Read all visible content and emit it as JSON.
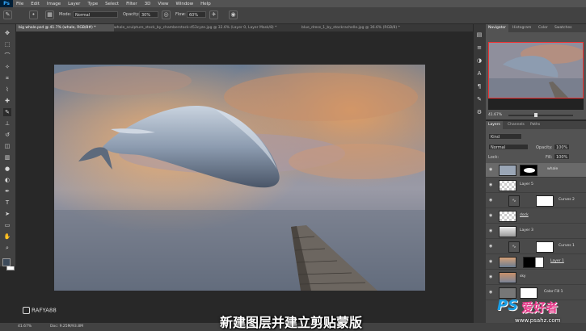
{
  "app": {
    "logo": "Ps"
  },
  "menu": [
    "File",
    "Edit",
    "Image",
    "Layer",
    "Type",
    "Select",
    "Filter",
    "3D",
    "View",
    "Window",
    "Help"
  ],
  "options": {
    "mode_label": "Mode:",
    "mode_value": "Normal",
    "opacity_label": "Opacity:",
    "opacity_value": "30%",
    "flow_label": "Flow:",
    "flow_value": "60%"
  },
  "tabs": [
    {
      "label": "big whale.psd @ 41.7% (whale, RGB/8#) *",
      "active": true
    },
    {
      "label": "whale_sculpture_stock_by_chamberstock-d53cyze.jpg @ 32.6% (Layer 0, Layer Mask/8) *",
      "active": false
    },
    {
      "label": "blue_dress_1_by_stockrachelle.jpg @ 36.6% (RGB/8) *",
      "active": false
    }
  ],
  "navigator": {
    "tabs": [
      "Navigator",
      "Histogram",
      "Color",
      "Swatches"
    ],
    "zoom": "41.67%"
  },
  "layers_panel": {
    "tabs": [
      "Layers",
      "Channels",
      "Paths"
    ],
    "kind_label": "Kind",
    "blend_mode": "Normal",
    "opacity_label": "Opacity:",
    "opacity_value": "100%",
    "lock_label": "Lock:",
    "fill_label": "Fill:",
    "fill_value": "100%",
    "layers": [
      {
        "name": "whale",
        "selected": true
      },
      {
        "name": "Layer 5",
        "selected": false
      },
      {
        "name": "Curves 2",
        "selected": false
      },
      {
        "name": "dock",
        "selected": false
      },
      {
        "name": "Layer 3",
        "selected": false
      },
      {
        "name": "Curves 1",
        "selected": false
      },
      {
        "name": "Layer 1",
        "selected": false
      },
      {
        "name": "sky",
        "selected": false
      },
      {
        "name": "Color Fill 1",
        "selected": false
      }
    ]
  },
  "status": {
    "zoom": "41.67%",
    "doc": "Doc: 9.25M/93.8M"
  },
  "overlay": {
    "caption": "新建图层并建立剪贴蒙版",
    "instagram": "RAFYA88",
    "watermark_logo": "PS",
    "watermark_text": "爱好者",
    "watermark_url": "www.psahz.com"
  },
  "colors": {
    "ps_blue": "#31a8ff",
    "panel": "#535353",
    "bg": "#282828"
  }
}
